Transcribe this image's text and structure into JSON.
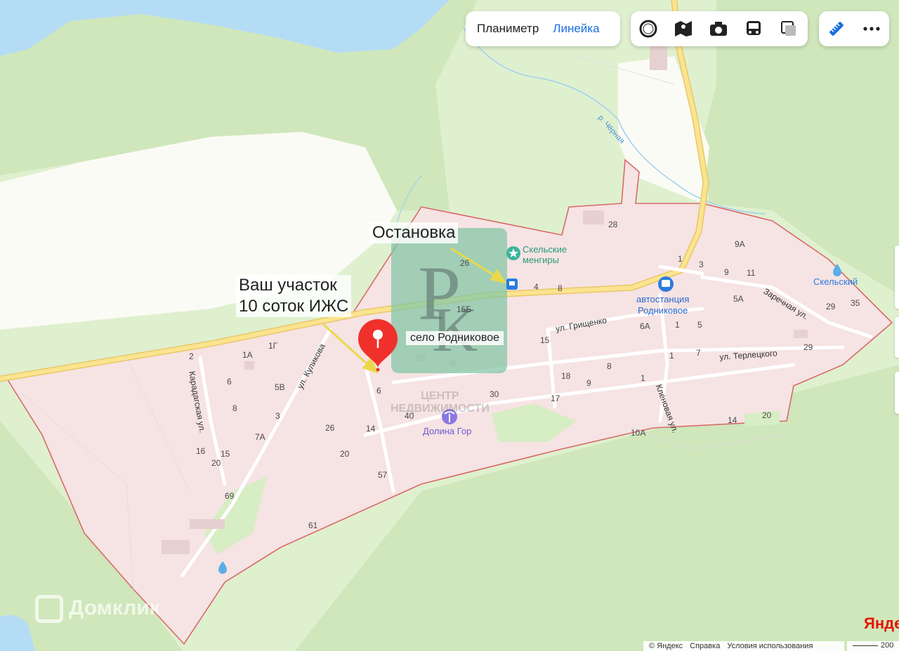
{
  "toolbar": {
    "planimeter_label": "Планиметр",
    "ruler_label": "Линейка",
    "layer_icons": [
      "circle-layer-icon",
      "panorama-icon",
      "photo-camera-icon",
      "bus-transport-icon",
      "layers-icon"
    ],
    "ruler_icon": "ruler-icon",
    "more_icon": "more-dots-icon"
  },
  "annotations": {
    "stop_label": "Остановка",
    "plot_label_line1": "Ваш участок",
    "plot_label_line2": "10 соток ИЖС"
  },
  "places": {
    "village_name": "село Родниковое",
    "menhirs_line1": "Скельские",
    "menhirs_line2": "менгиры",
    "bus_station_line1": "автостанция",
    "bus_station_line2": "Родниковое",
    "skelsky": "Скельский",
    "dolina_gor": "Долина Гор",
    "river": "р. Чёрная"
  },
  "streets": {
    "kulikova": "ул. Куликова",
    "karadagskaya": "Карадагская ул.",
    "grishchenko": "ул. Грищенко",
    "terletskogo": "ул. Терлецкого",
    "zarechnaya": "Заречная ул.",
    "klenovaya": "Кленовая ул."
  },
  "house_numbers": [
    "28",
    "9А",
    "3",
    "9",
    "11",
    "1",
    "26",
    "4",
    "8",
    "5А",
    "29",
    "35",
    "15Б",
    "6А",
    "1",
    "5",
    "15",
    "29",
    "1",
    "7",
    "8",
    "18",
    "9",
    "1",
    "2",
    "1А",
    "1Г",
    "6",
    "5В",
    "8",
    "3",
    "7А",
    "16",
    "15",
    "20",
    "26",
    "14",
    "40",
    "6",
    "20",
    "30",
    "17",
    "14",
    "20",
    "10А",
    "57",
    "69",
    "61"
  ],
  "watermark": {
    "center_text_line1": "ЦЕНТР",
    "center_text_line2": "НЕДВИЖИМОСТИ",
    "domclick": "Домклик"
  },
  "footer": {
    "copyright": "© Яндекс",
    "help": "Справка",
    "terms": "Условия использования",
    "scale_value": "200",
    "logo": "Янде"
  },
  "colors": {
    "settlement_fill": "#f6e3e3",
    "settlement_border": "#d96a6a",
    "forest": "#cfeabb",
    "water": "#b5dcf5",
    "road": "#fbe48f",
    "accent_blue": "#1a6fe0",
    "pin_red": "#f0302a",
    "annotation_arrow": "#e9d84a"
  }
}
